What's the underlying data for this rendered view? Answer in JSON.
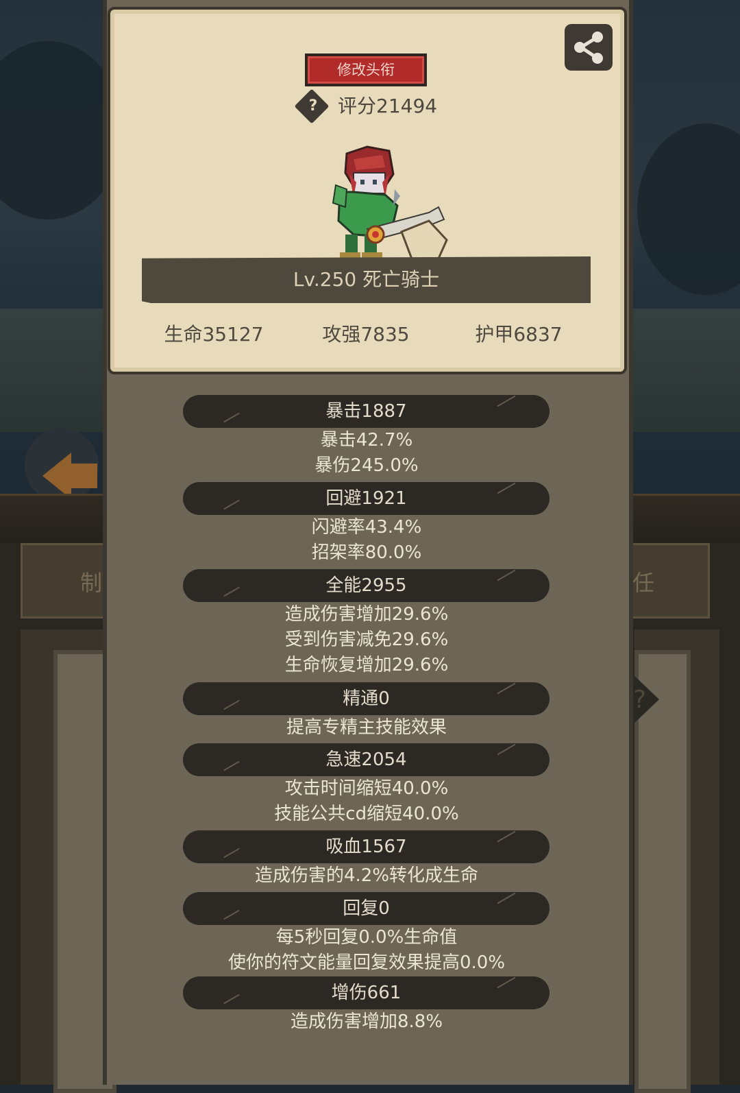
{
  "background": {
    "tab_left_label": "制",
    "tab_right_label": "任",
    "icons": [
      "back-arrow-icon",
      "help-icon"
    ]
  },
  "profile": {
    "rename_button": "修改头衔",
    "help_icon": "?",
    "score": "评分21494",
    "share_icon": "share-icon",
    "level_title": "Lv.250 死亡骑士",
    "stats": {
      "hp": "生命35127",
      "attack": "攻强7835",
      "armor": "护甲6837"
    }
  },
  "attributes": [
    {
      "title": "暴击1887",
      "lines": [
        "暴击42.7%",
        "暴伤245.0%"
      ]
    },
    {
      "title": "回避1921",
      "lines": [
        "闪避率43.4%",
        "招架率80.0%"
      ]
    },
    {
      "title": "全能2955",
      "lines": [
        "造成伤害增加29.6%",
        "受到伤害减免29.6%",
        "生命恢复增加29.6%"
      ]
    },
    {
      "title": "精通0",
      "lines": [
        "提高专精主技能效果"
      ]
    },
    {
      "title": "急速2054",
      "lines": [
        "攻击时间缩短40.0%",
        "技能公共cd缩短40.0%"
      ]
    },
    {
      "title": "吸血1567",
      "lines": [
        "造成伤害的4.2%转化成生命"
      ]
    },
    {
      "title": "回复0",
      "lines": [
        "每5秒回复0.0%生命值",
        "使你的符文能量回复效果提高0.0%"
      ]
    },
    {
      "title": "增伤661",
      "lines": [
        "造成伤害增加8.8%"
      ]
    }
  ],
  "colors": {
    "card_bg": "#e7dbbb",
    "panel_bg": "#6d6656",
    "header_bg": "#2c2925",
    "rename_red": "#b22b2b"
  }
}
